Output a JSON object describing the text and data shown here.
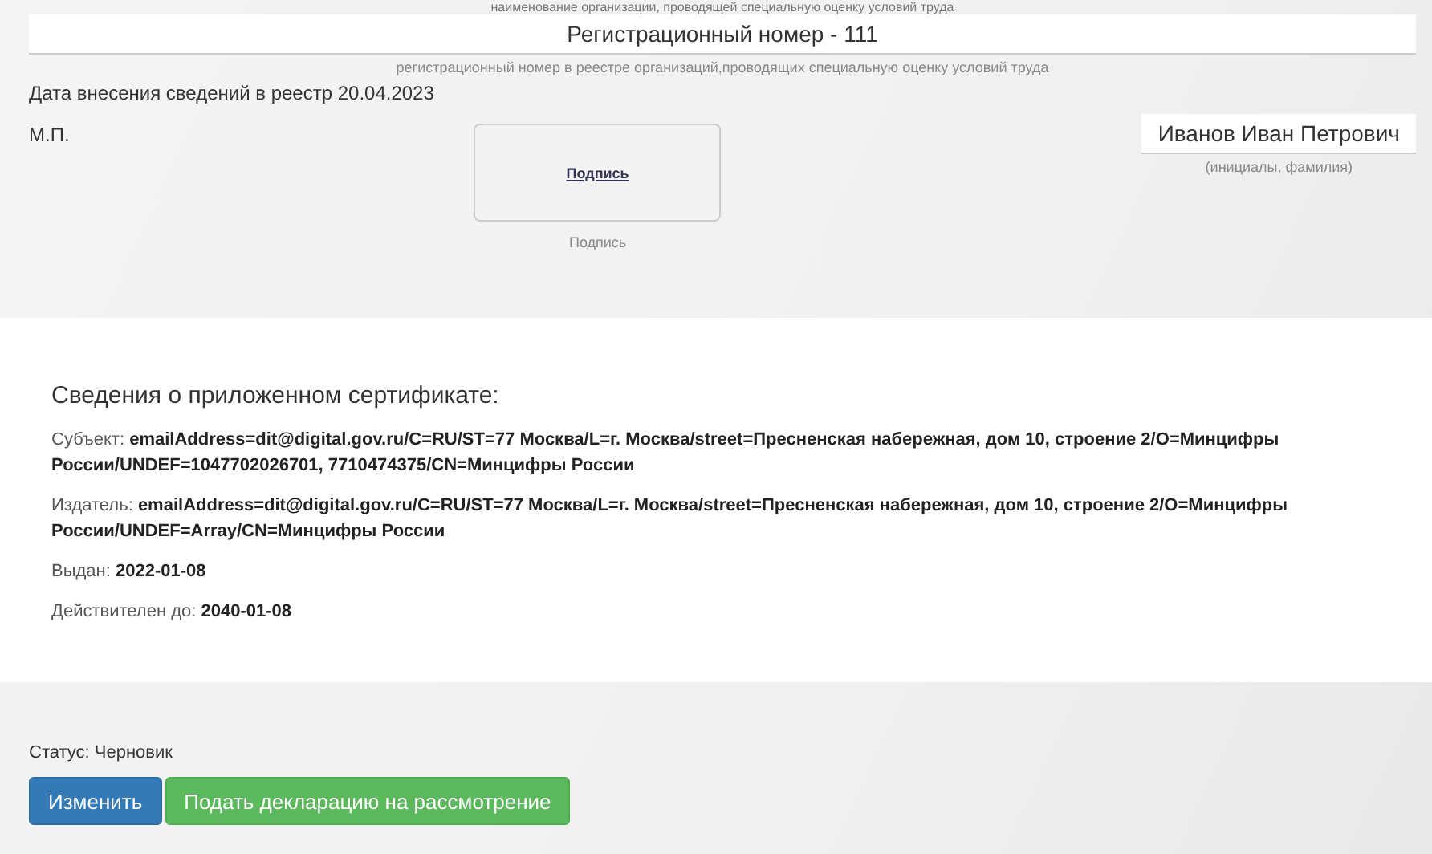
{
  "top_caption": "наименование организации, проводящей специальную оценку условий труда",
  "registration": {
    "value": "Регистрационный номер - 111",
    "caption": "регистрационный номер в реестре организаций,проводящих специальную оценку условий труда"
  },
  "registry_date": "Дата внесения сведений в реестр 20.04.2023",
  "stamp_label": "М.П.",
  "signature": {
    "link": "Подпись",
    "caption": "Подпись"
  },
  "signer": {
    "name": "Иванов Иван Петрович",
    "caption": "(инициалы, фамилия)"
  },
  "certificate": {
    "title": "Сведения о приложенном сертификате:",
    "fields": [
      {
        "label": "Субъект:",
        "value": "emailAddress=dit@digital.gov.ru/C=RU/ST=77 Москва/L=г. Москва/street=Пресненская набережная, дом 10, строение 2/O=Минцифры России/UNDEF=1047702026701, 7710474375/CN=Минцифры России"
      },
      {
        "label": "Издатель:",
        "value": "emailAddress=dit@digital.gov.ru/C=RU/ST=77 Москва/L=г. Москва/street=Пресненская набережная, дом 10, строение 2/O=Минцифры России/UNDEF=Array/CN=Минцифры России"
      },
      {
        "label": "Выдан:",
        "value": "2022-01-08"
      },
      {
        "label": "Действителен до:",
        "value": "2040-01-08"
      }
    ]
  },
  "status": "Статус: Черновик",
  "buttons": [
    {
      "label": "Изменить",
      "kind": "primary"
    },
    {
      "label": "Подать декларацию на рассмотрение",
      "kind": "success"
    }
  ]
}
